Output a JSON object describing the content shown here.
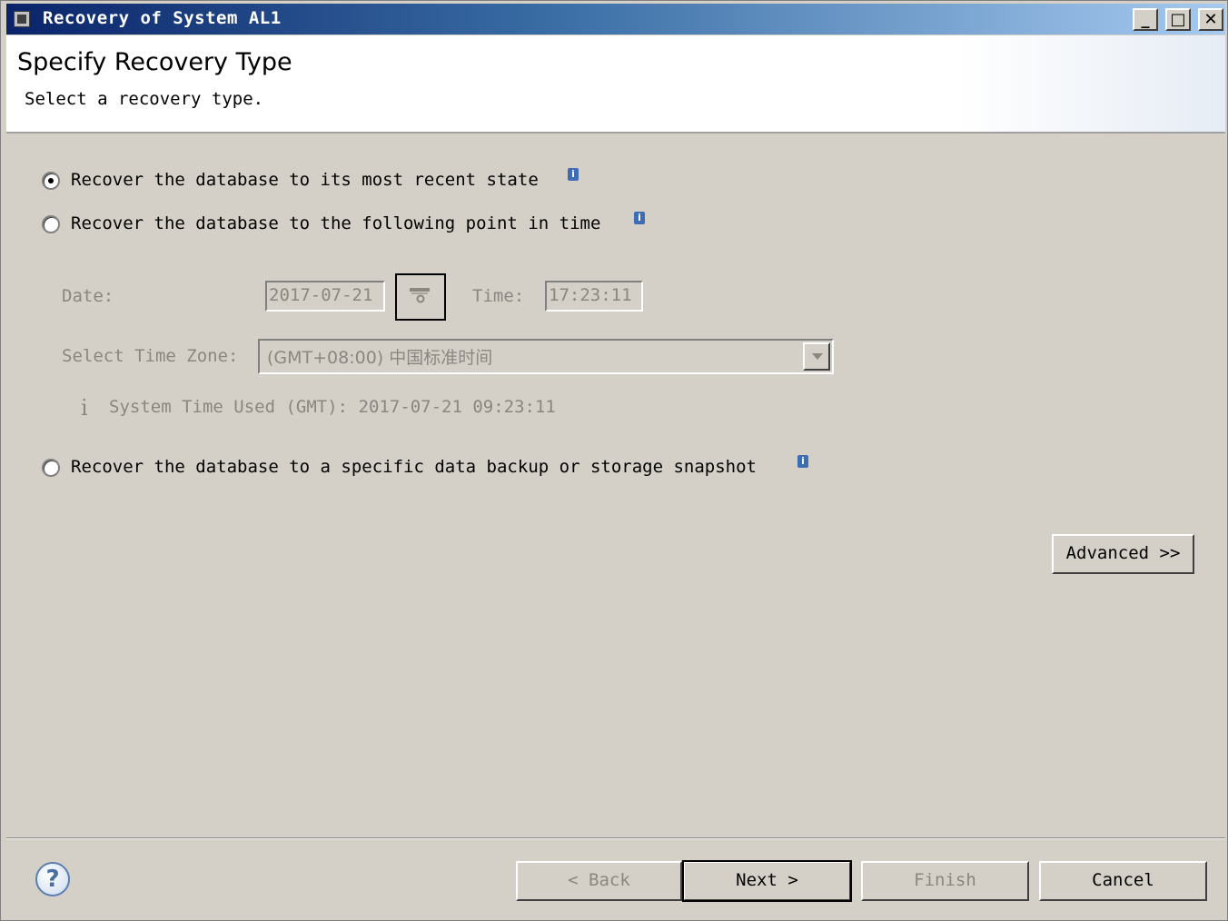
{
  "window": {
    "title": "Recovery of System AL1",
    "minimize_label": "_",
    "maximize_label": "□",
    "close_label": "✕"
  },
  "header": {
    "title": "Specify Recovery Type",
    "subtitle": "Select a recovery type."
  },
  "options": {
    "most_recent": {
      "label": "Recover the database to its most recent state",
      "selected": true
    },
    "point_in_time": {
      "label": "Recover the database to the following point in time",
      "selected": false
    },
    "backup_snapshot": {
      "label": "Recover the database to a specific data backup or storage snapshot",
      "selected": false
    },
    "info_glyph": "i"
  },
  "point_in_time": {
    "date_label": "Date:",
    "date_value": "2017-07-21",
    "time_label": "Time:",
    "time_value": "17:23:11",
    "timezone_label": "Select Time Zone:",
    "timezone_value": "(GMT+08:00) 中国标准时间",
    "info_icon": "i",
    "system_time_text": "System Time Used (GMT): 2017-07-21 09:23:11"
  },
  "advanced_button": "Advanced >>",
  "footer": {
    "help_label": "?",
    "back_label": "< Back",
    "next_label": "Next >",
    "finish_label": "Finish",
    "cancel_label": "Cancel"
  }
}
